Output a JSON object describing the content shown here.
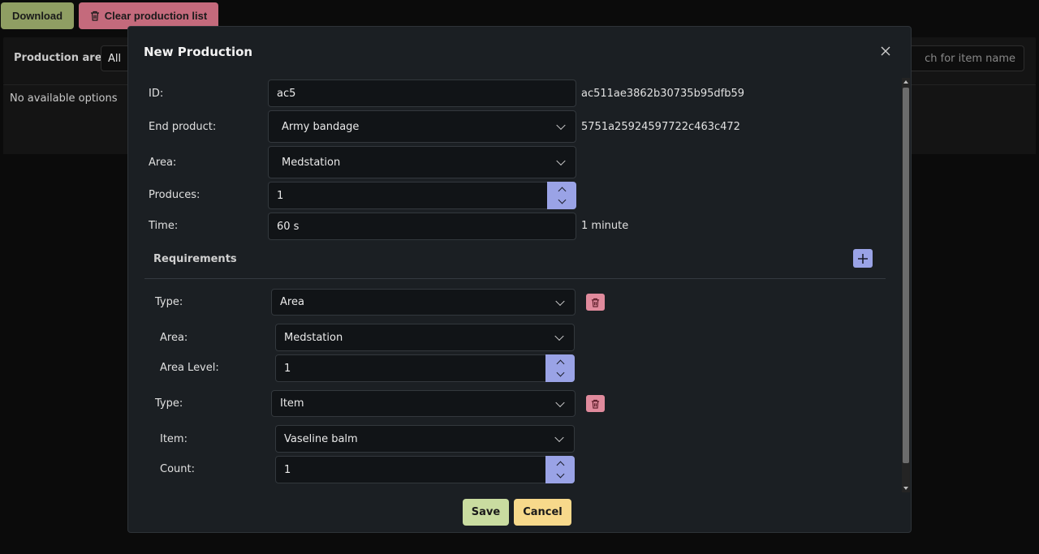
{
  "toolbar": {
    "download_label": "Download",
    "clear_label": "Clear production list"
  },
  "filters": {
    "area_label": "Production area",
    "area_value": "All",
    "search_placeholder": "Search for item name",
    "search_visible": "ch for item name"
  },
  "results": {
    "empty_text": "No available options"
  },
  "modal": {
    "title": "New Production",
    "id_label": "ID:",
    "id_value": "ac5",
    "id_hash": "ac511ae3862b30735b95dfb59",
    "end_product_label": "End product:",
    "end_product_value": "Army bandage",
    "end_product_hash": "5751a25924597722c463c472",
    "area_label": "Area:",
    "area_value": "Medstation",
    "produces_label": "Produces:",
    "produces_value": "1",
    "time_label": "Time:",
    "time_value": "60 s",
    "time_human": "1 minute",
    "requirements_label": "Requirements",
    "requirements": [
      {
        "type_label": "Type:",
        "type_value": "Area",
        "field1_label": "Area:",
        "field1_value": "Medstation",
        "field2_label": "Area Level:",
        "field2_value": "1"
      },
      {
        "type_label": "Type:",
        "type_value": "Item",
        "field1_label": "Item:",
        "field1_value": "Vaseline balm",
        "field2_label": "Count:",
        "field2_value": "1"
      }
    ],
    "save_label": "Save",
    "cancel_label": "Cancel"
  },
  "colors": {
    "download": "#8f9e63",
    "clear": "#c46a7c",
    "accent": "#9aa3e6",
    "delete": "#e08a9c",
    "save": "#c9dca0",
    "cancel": "#f7d98b"
  }
}
